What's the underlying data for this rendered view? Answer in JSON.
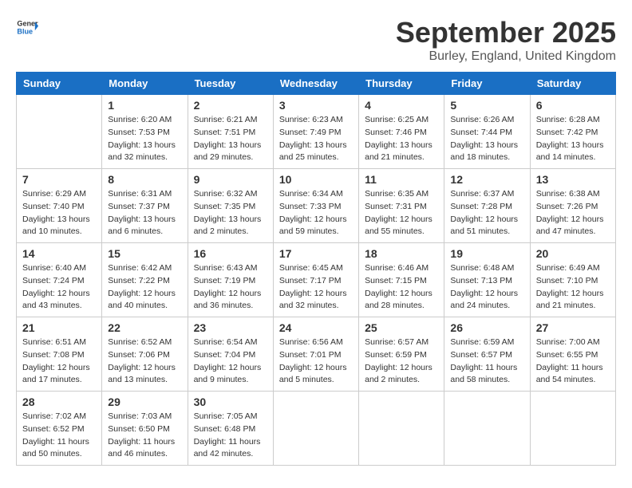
{
  "logo": {
    "general": "General",
    "blue": "Blue"
  },
  "title": "September 2025",
  "location": "Burley, England, United Kingdom",
  "days_of_week": [
    "Sunday",
    "Monday",
    "Tuesday",
    "Wednesday",
    "Thursday",
    "Friday",
    "Saturday"
  ],
  "weeks": [
    [
      {
        "day": "",
        "info": ""
      },
      {
        "day": "1",
        "info": "Sunrise: 6:20 AM\nSunset: 7:53 PM\nDaylight: 13 hours\nand 32 minutes."
      },
      {
        "day": "2",
        "info": "Sunrise: 6:21 AM\nSunset: 7:51 PM\nDaylight: 13 hours\nand 29 minutes."
      },
      {
        "day": "3",
        "info": "Sunrise: 6:23 AM\nSunset: 7:49 PM\nDaylight: 13 hours\nand 25 minutes."
      },
      {
        "day": "4",
        "info": "Sunrise: 6:25 AM\nSunset: 7:46 PM\nDaylight: 13 hours\nand 21 minutes."
      },
      {
        "day": "5",
        "info": "Sunrise: 6:26 AM\nSunset: 7:44 PM\nDaylight: 13 hours\nand 18 minutes."
      },
      {
        "day": "6",
        "info": "Sunrise: 6:28 AM\nSunset: 7:42 PM\nDaylight: 13 hours\nand 14 minutes."
      }
    ],
    [
      {
        "day": "7",
        "info": "Sunrise: 6:29 AM\nSunset: 7:40 PM\nDaylight: 13 hours\nand 10 minutes."
      },
      {
        "day": "8",
        "info": "Sunrise: 6:31 AM\nSunset: 7:37 PM\nDaylight: 13 hours\nand 6 minutes."
      },
      {
        "day": "9",
        "info": "Sunrise: 6:32 AM\nSunset: 7:35 PM\nDaylight: 13 hours\nand 2 minutes."
      },
      {
        "day": "10",
        "info": "Sunrise: 6:34 AM\nSunset: 7:33 PM\nDaylight: 12 hours\nand 59 minutes."
      },
      {
        "day": "11",
        "info": "Sunrise: 6:35 AM\nSunset: 7:31 PM\nDaylight: 12 hours\nand 55 minutes."
      },
      {
        "day": "12",
        "info": "Sunrise: 6:37 AM\nSunset: 7:28 PM\nDaylight: 12 hours\nand 51 minutes."
      },
      {
        "day": "13",
        "info": "Sunrise: 6:38 AM\nSunset: 7:26 PM\nDaylight: 12 hours\nand 47 minutes."
      }
    ],
    [
      {
        "day": "14",
        "info": "Sunrise: 6:40 AM\nSunset: 7:24 PM\nDaylight: 12 hours\nand 43 minutes."
      },
      {
        "day": "15",
        "info": "Sunrise: 6:42 AM\nSunset: 7:22 PM\nDaylight: 12 hours\nand 40 minutes."
      },
      {
        "day": "16",
        "info": "Sunrise: 6:43 AM\nSunset: 7:19 PM\nDaylight: 12 hours\nand 36 minutes."
      },
      {
        "day": "17",
        "info": "Sunrise: 6:45 AM\nSunset: 7:17 PM\nDaylight: 12 hours\nand 32 minutes."
      },
      {
        "day": "18",
        "info": "Sunrise: 6:46 AM\nSunset: 7:15 PM\nDaylight: 12 hours\nand 28 minutes."
      },
      {
        "day": "19",
        "info": "Sunrise: 6:48 AM\nSunset: 7:13 PM\nDaylight: 12 hours\nand 24 minutes."
      },
      {
        "day": "20",
        "info": "Sunrise: 6:49 AM\nSunset: 7:10 PM\nDaylight: 12 hours\nand 21 minutes."
      }
    ],
    [
      {
        "day": "21",
        "info": "Sunrise: 6:51 AM\nSunset: 7:08 PM\nDaylight: 12 hours\nand 17 minutes."
      },
      {
        "day": "22",
        "info": "Sunrise: 6:52 AM\nSunset: 7:06 PM\nDaylight: 12 hours\nand 13 minutes."
      },
      {
        "day": "23",
        "info": "Sunrise: 6:54 AM\nSunset: 7:04 PM\nDaylight: 12 hours\nand 9 minutes."
      },
      {
        "day": "24",
        "info": "Sunrise: 6:56 AM\nSunset: 7:01 PM\nDaylight: 12 hours\nand 5 minutes."
      },
      {
        "day": "25",
        "info": "Sunrise: 6:57 AM\nSunset: 6:59 PM\nDaylight: 12 hours\nand 2 minutes."
      },
      {
        "day": "26",
        "info": "Sunrise: 6:59 AM\nSunset: 6:57 PM\nDaylight: 11 hours\nand 58 minutes."
      },
      {
        "day": "27",
        "info": "Sunrise: 7:00 AM\nSunset: 6:55 PM\nDaylight: 11 hours\nand 54 minutes."
      }
    ],
    [
      {
        "day": "28",
        "info": "Sunrise: 7:02 AM\nSunset: 6:52 PM\nDaylight: 11 hours\nand 50 minutes."
      },
      {
        "day": "29",
        "info": "Sunrise: 7:03 AM\nSunset: 6:50 PM\nDaylight: 11 hours\nand 46 minutes."
      },
      {
        "day": "30",
        "info": "Sunrise: 7:05 AM\nSunset: 6:48 PM\nDaylight: 11 hours\nand 42 minutes."
      },
      {
        "day": "",
        "info": ""
      },
      {
        "day": "",
        "info": ""
      },
      {
        "day": "",
        "info": ""
      },
      {
        "day": "",
        "info": ""
      }
    ]
  ]
}
